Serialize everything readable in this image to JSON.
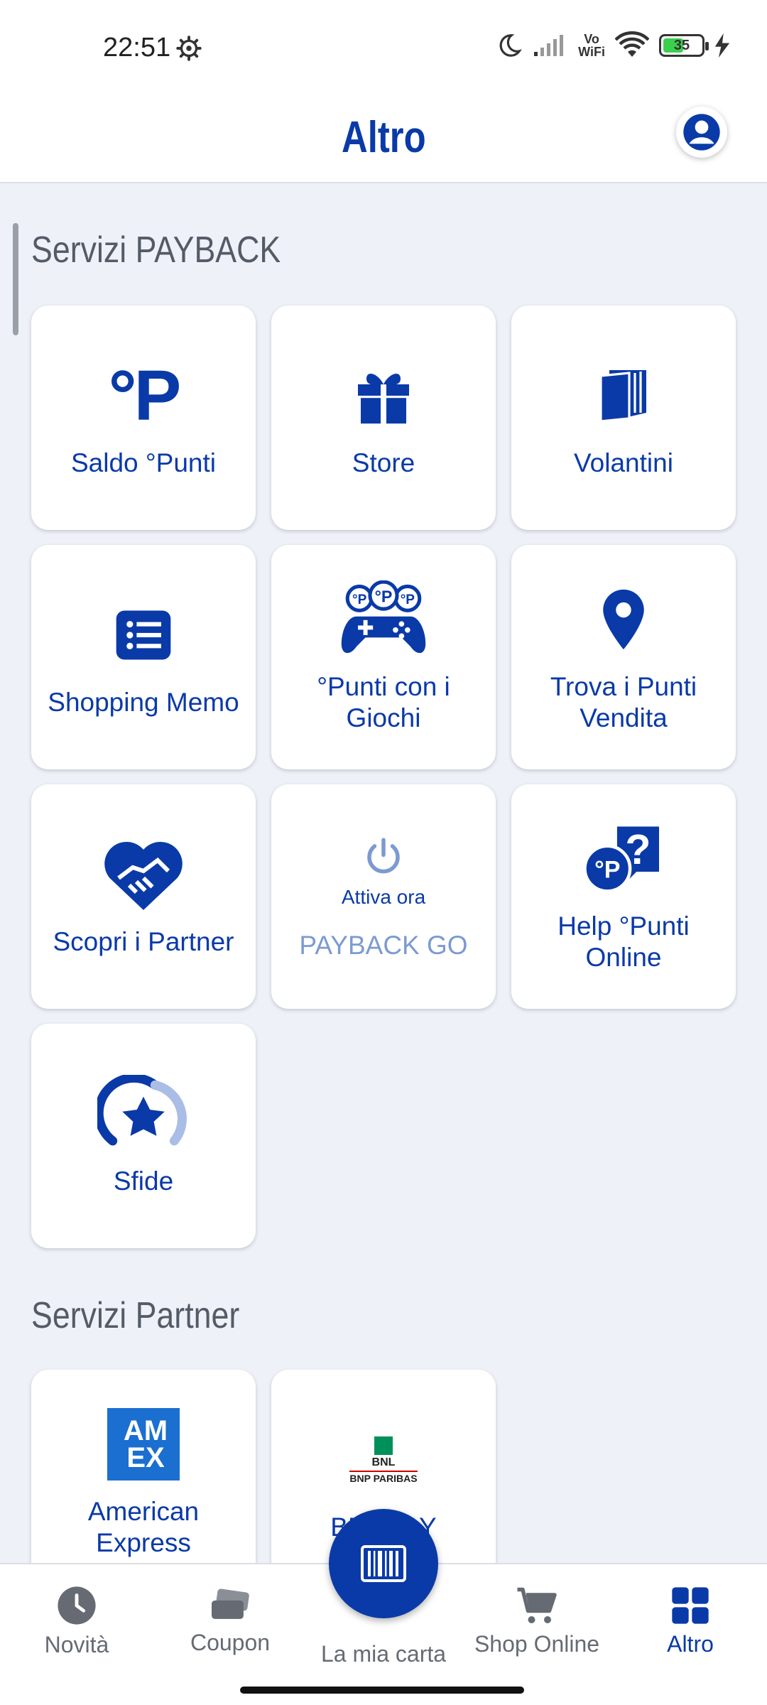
{
  "status_bar": {
    "time": "22:51",
    "battery": "35",
    "vowifi_top": "Vo",
    "vowifi_bottom": "WiFi"
  },
  "header": {
    "title": "Altro"
  },
  "sections": {
    "payback": {
      "title": "Servizi PAYBACK",
      "tiles": [
        {
          "label": "Saldo °Punti",
          "icon": "points-icon"
        },
        {
          "label": "Store",
          "icon": "gift-icon"
        },
        {
          "label": "Volantini",
          "icon": "flyers-icon"
        },
        {
          "label": "Shopping Memo",
          "icon": "list-icon"
        },
        {
          "label": "°Punti con i Giochi",
          "icon": "gamepad-icon"
        },
        {
          "label": "Trova i Punti Vendita",
          "icon": "location-pin-icon"
        },
        {
          "label": "Scopri i Partner",
          "icon": "handshake-heart-icon"
        },
        {
          "label": "PAYBACK GO",
          "sublabel": "Attiva ora",
          "icon": "power-icon"
        },
        {
          "label": "Help °Punti Online",
          "icon": "help-icon"
        },
        {
          "label": "Sfide",
          "icon": "star-gauge-icon"
        }
      ]
    },
    "partner": {
      "title": "Servizi Partner",
      "tiles": [
        {
          "label": "American Express",
          "icon": "amex-logo-icon",
          "logo_text_1": "AM",
          "logo_text_2": "EX"
        },
        {
          "label": "BNL PAY",
          "icon": "bnl-logo-icon",
          "logo_text_1": "BNL",
          "logo_text_2": "BNP PARIBAS"
        }
      ]
    }
  },
  "bottom_nav": {
    "items": [
      {
        "label": "Novità",
        "icon": "clock-icon"
      },
      {
        "label": "Coupon",
        "icon": "coupon-icon"
      },
      {
        "label": "La mia carta",
        "icon": "barcode-icon"
      },
      {
        "label": "Shop Online",
        "icon": "cart-icon"
      },
      {
        "label": "Altro",
        "icon": "grid-icon",
        "active": true
      }
    ]
  },
  "colors": {
    "brand_blue": "#0a3aa8",
    "background": "#eef2f8",
    "muted_blue": "#7c9ad2"
  }
}
